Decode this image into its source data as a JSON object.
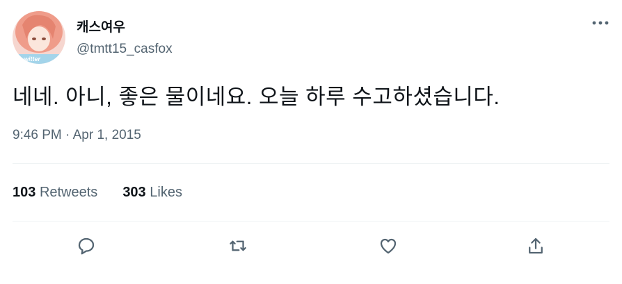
{
  "author": {
    "display_name": "캐스여우",
    "handle": "@tmtt15_casfox",
    "avatar_caption": "witter"
  },
  "tweet": {
    "text": "네네. 아니, 좋은 물이네요. 오늘 하루 수고하셨습니다.",
    "time": "9:46 PM",
    "separator": "·",
    "date": "Apr 1, 2015"
  },
  "stats": {
    "retweets_count": "103",
    "retweets_label": "Retweets",
    "likes_count": "303",
    "likes_label": "Likes"
  },
  "icons": {
    "more": "more-horizontal-icon",
    "reply": "reply-bubble-icon",
    "retweet": "retweet-arrows-icon",
    "like": "heart-icon",
    "share": "share-upload-icon"
  },
  "colors": {
    "text_primary": "#0f1419",
    "text_secondary": "#536471",
    "divider": "#eff3f4"
  }
}
